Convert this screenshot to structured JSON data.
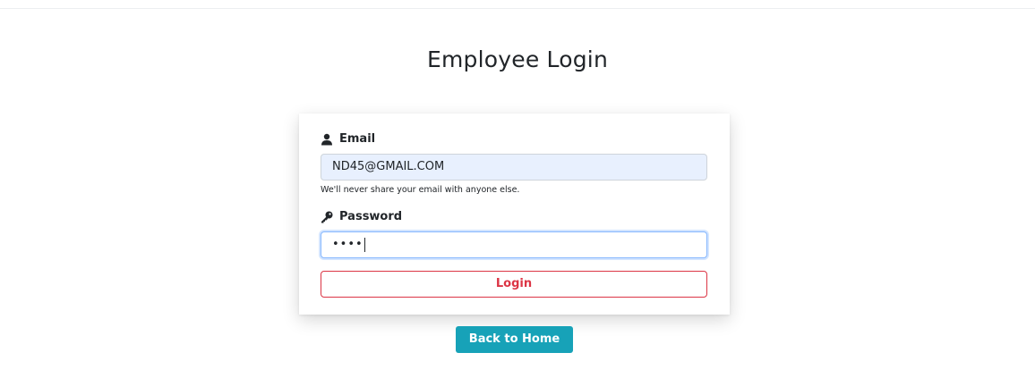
{
  "page": {
    "title": "Employee Login"
  },
  "form": {
    "email": {
      "label": "Email",
      "icon": "user-icon",
      "value": "ND45@GMAIL.COM",
      "help": "We'll never share your email with anyone else."
    },
    "password": {
      "label": "Password",
      "icon": "key-icon",
      "masked_value": "••••"
    },
    "login_label": "Login"
  },
  "footer": {
    "home_label": "Back to Home"
  },
  "colors": {
    "danger": "#dc3545",
    "info": "#17a2b8",
    "autofill_bg": "#e8f0fe",
    "focus_border": "#86b7fe"
  }
}
